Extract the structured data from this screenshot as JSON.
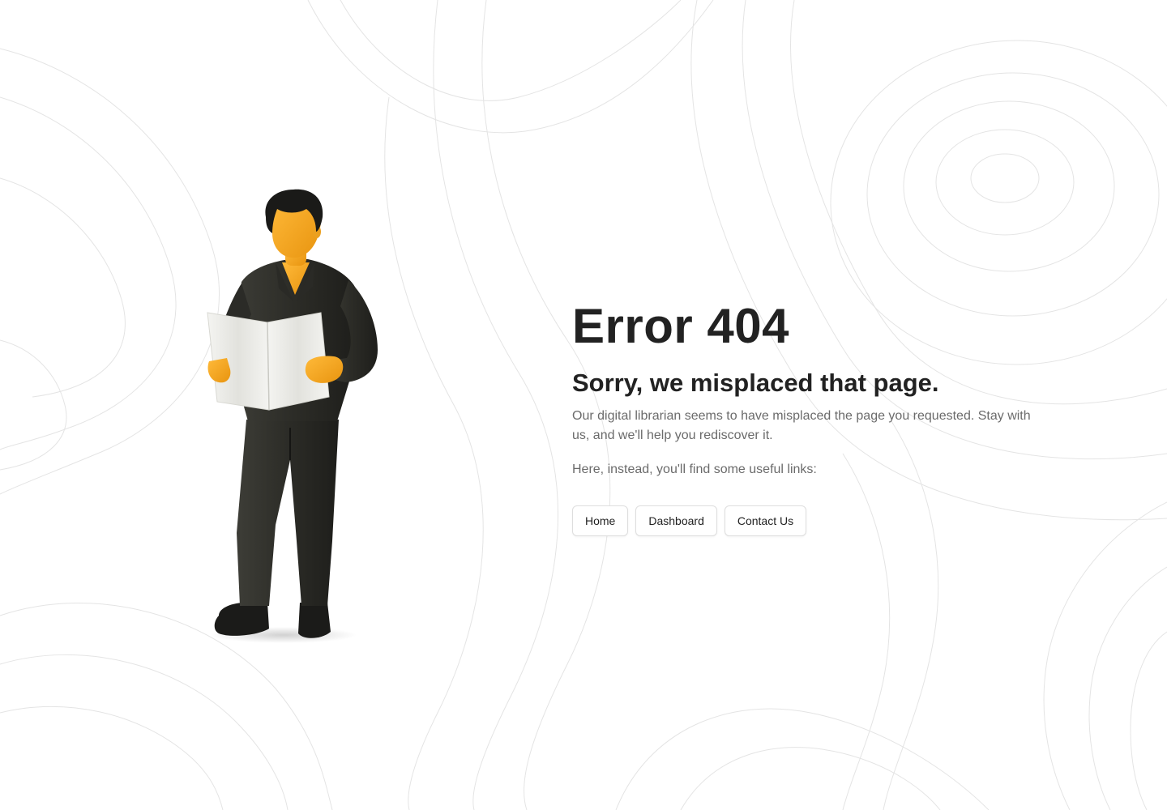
{
  "background": {
    "color": "#ffffff",
    "pattern": "topographic-contour-lines",
    "pattern_color": "#e4e4e4"
  },
  "illustration": {
    "icon": "man-reading-map-illustration",
    "colors": {
      "skin": "#f5a623",
      "clothing": "#2f2f2a",
      "hair": "#1a1a1a",
      "paper": "#f0f0ec"
    }
  },
  "error": {
    "title": "Error 404",
    "subtitle": "Sorry, we misplaced that page.",
    "description": "Our digital librarian seems to have misplaced the page you requested. Stay with us, and we'll help you rediscover it.",
    "links_intro": "Here, instead, you'll find some useful links:"
  },
  "links": [
    {
      "label": "Home"
    },
    {
      "label": "Dashboard"
    },
    {
      "label": "Contact Us"
    }
  ]
}
